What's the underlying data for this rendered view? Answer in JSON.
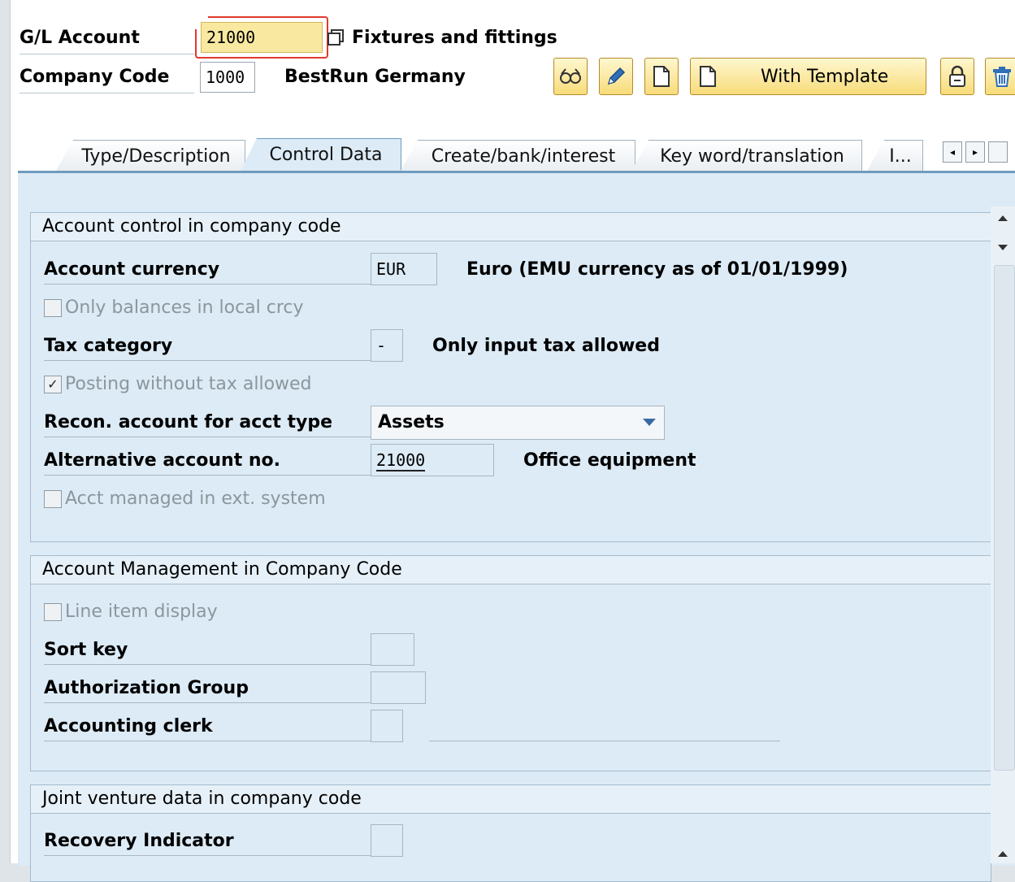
{
  "header": {
    "gl_account_label": "G/L Account",
    "gl_account_value": "21000",
    "gl_account_desc": "Fixtures and fittings",
    "company_code_label": "Company Code",
    "company_code_value": "1000",
    "company_code_desc": "BestRun Germany",
    "toolbar": {
      "display_icon": "glasses-icon",
      "change_icon": "pencil-icon",
      "create_icon": "document-icon",
      "with_template_label": "With Template",
      "lock_icon": "lock-icon",
      "delete_icon": "trash-icon"
    }
  },
  "tabs": [
    {
      "label": "Type/Description",
      "active": false
    },
    {
      "label": "Control Data",
      "active": true
    },
    {
      "label": "Create/bank/interest",
      "active": false
    },
    {
      "label": "Key word/translation",
      "active": false
    },
    {
      "label": "I...",
      "active": false
    }
  ],
  "groups": {
    "account_control": {
      "title": "Account control in company code",
      "account_currency_label": "Account currency",
      "account_currency_value": "EUR",
      "account_currency_desc": "Euro (EMU currency as of 01/01/1999)",
      "only_balances_label": "Only balances in local crcy",
      "tax_category_label": "Tax category",
      "tax_category_value": "-",
      "tax_category_desc": "Only input tax allowed",
      "posting_without_tax_label": "Posting without tax allowed",
      "recon_label": "Recon. account for acct type",
      "recon_value": "Assets",
      "alt_account_label": "Alternative account no.",
      "alt_account_value": "21000",
      "alt_account_desc": "Office equipment",
      "ext_system_label": "Acct managed in ext. system"
    },
    "account_management": {
      "title": "Account Management in Company Code",
      "line_item_label": "Line item display",
      "sort_key_label": "Sort key",
      "auth_group_label": "Authorization Group",
      "clerk_label": "Accounting clerk"
    },
    "joint_venture": {
      "title": "Joint venture data in company code",
      "recovery_label": "Recovery Indicator"
    }
  }
}
